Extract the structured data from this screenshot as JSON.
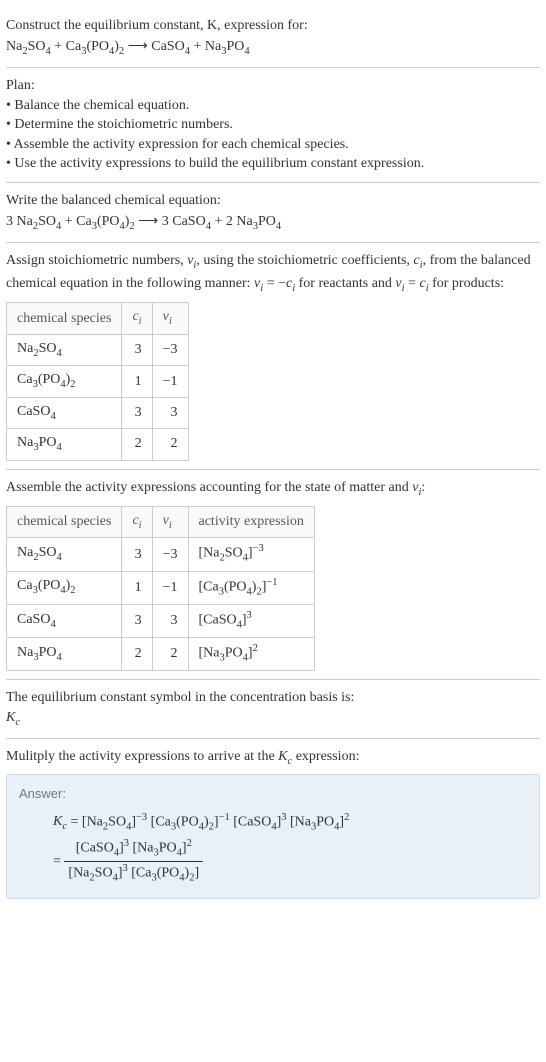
{
  "prompt": {
    "intro": "Construct the equilibrium constant, K, expression for:",
    "equation_html": "Na<sub>2</sub>SO<sub>4</sub> + Ca<sub>3</sub>(PO<sub>4</sub>)<sub>2</sub> <span class='arrow'>⟶</span> CaSO<sub>4</sub> + Na<sub>3</sub>PO<sub>4</sub>"
  },
  "plan": {
    "heading": "Plan:",
    "items": [
      "Balance the chemical equation.",
      "Determine the stoichiometric numbers.",
      "Assemble the activity expression for each chemical species.",
      "Use the activity expressions to build the equilibrium constant expression."
    ]
  },
  "balanced": {
    "heading": "Write the balanced chemical equation:",
    "equation_html": "3 Na<sub>2</sub>SO<sub>4</sub> + Ca<sub>3</sub>(PO<sub>4</sub>)<sub>2</sub> <span class='arrow'>⟶</span> 3 CaSO<sub>4</sub> + 2 Na<sub>3</sub>PO<sub>4</sub>"
  },
  "stoich": {
    "heading_html": "Assign stoichiometric numbers, <span class='italic'>ν<sub>i</sub></span>, using the stoichiometric coefficients, <span class='italic'>c<sub>i</sub></span>, from the balanced chemical equation in the following manner: <span class='italic'>ν<sub>i</sub></span> = −<span class='italic'>c<sub>i</sub></span> for reactants and <span class='italic'>ν<sub>i</sub></span> = <span class='italic'>c<sub>i</sub></span> for products:",
    "headers": {
      "species": "chemical species",
      "ci_html": "<span class='italic'>c<sub>i</sub></span>",
      "vi_html": "<span class='italic'>ν<sub>i</sub></span>"
    },
    "rows": [
      {
        "species_html": "Na<sub>2</sub>SO<sub>4</sub>",
        "ci": "3",
        "vi": "−3"
      },
      {
        "species_html": "Ca<sub>3</sub>(PO<sub>4</sub>)<sub>2</sub>",
        "ci": "1",
        "vi": "−1"
      },
      {
        "species_html": "CaSO<sub>4</sub>",
        "ci": "3",
        "vi": "3"
      },
      {
        "species_html": "Na<sub>3</sub>PO<sub>4</sub>",
        "ci": "2",
        "vi": "2"
      }
    ]
  },
  "activity": {
    "heading_html": "Assemble the activity expressions accounting for the state of matter and <span class='italic'>ν<sub>i</sub></span>:",
    "headers": {
      "species": "chemical species",
      "ci_html": "<span class='italic'>c<sub>i</sub></span>",
      "vi_html": "<span class='italic'>ν<sub>i</sub></span>",
      "expr": "activity expression"
    },
    "rows": [
      {
        "species_html": "Na<sub>2</sub>SO<sub>4</sub>",
        "ci": "3",
        "vi": "−3",
        "expr_html": "[Na<sub>2</sub>SO<sub>4</sub>]<sup>−3</sup>"
      },
      {
        "species_html": "Ca<sub>3</sub>(PO<sub>4</sub>)<sub>2</sub>",
        "ci": "1",
        "vi": "−1",
        "expr_html": "[Ca<sub>3</sub>(PO<sub>4</sub>)<sub>2</sub>]<sup>−1</sup>"
      },
      {
        "species_html": "CaSO<sub>4</sub>",
        "ci": "3",
        "vi": "3",
        "expr_html": "[CaSO<sub>4</sub>]<sup>3</sup>"
      },
      {
        "species_html": "Na<sub>3</sub>PO<sub>4</sub>",
        "ci": "2",
        "vi": "2",
        "expr_html": "[Na<sub>3</sub>PO<sub>4</sub>]<sup>2</sup>"
      }
    ]
  },
  "symbol": {
    "heading": "The equilibrium constant symbol in the concentration basis is:",
    "value_html": "<span class='italic'>K<sub>c</sub></span>"
  },
  "multiply": {
    "heading_html": "Mulitply the activity expressions to arrive at the <span class='italic'>K<sub>c</sub></span> expression:"
  },
  "answer": {
    "label": "Answer:",
    "line1_html": "<span class='italic'>K<sub>c</sub></span> = [Na<sub>2</sub>SO<sub>4</sub>]<sup>−3</sup> [Ca<sub>3</sub>(PO<sub>4</sub>)<sub>2</sub>]<sup>−1</sup> [CaSO<sub>4</sub>]<sup>3</sup> [Na<sub>3</sub>PO<sub>4</sub>]<sup>2</sup>",
    "frac_num_html": "[CaSO<sub>4</sub>]<sup>3</sup> [Na<sub>3</sub>PO<sub>4</sub>]<sup>2</sup>",
    "frac_den_html": "[Na<sub>2</sub>SO<sub>4</sub>]<sup>3</sup> [Ca<sub>3</sub>(PO<sub>4</sub>)<sub>2</sub>]",
    "equals": "= "
  }
}
